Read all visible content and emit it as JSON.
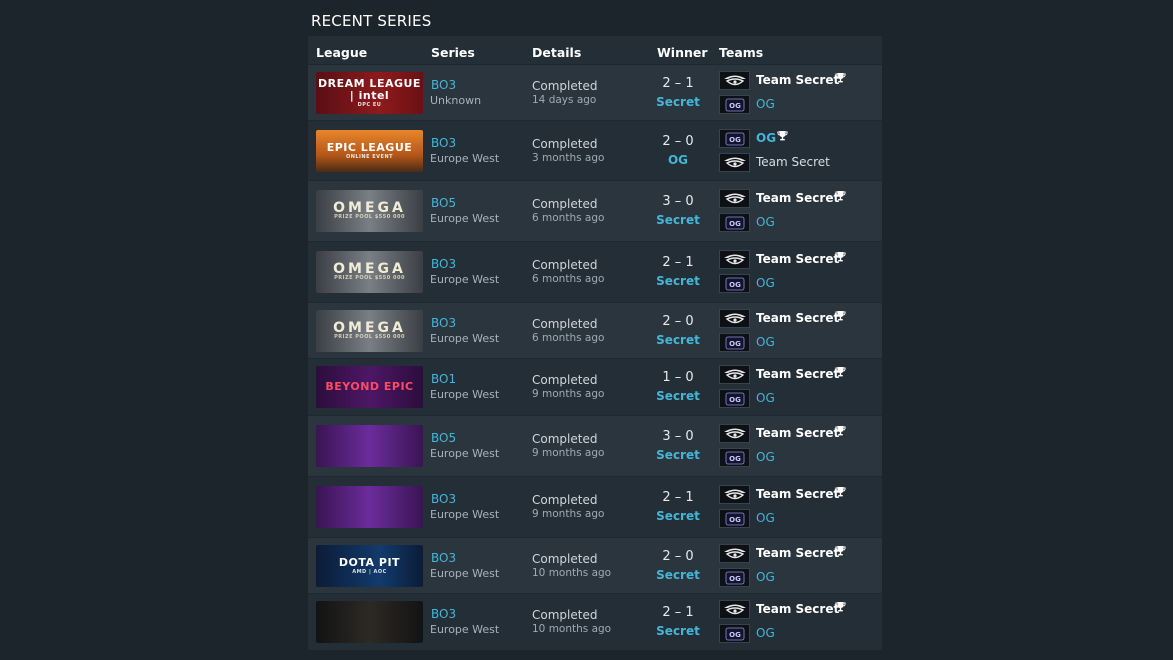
{
  "section_title": "RECENT SERIES",
  "columns": {
    "league": "League",
    "series": "Series",
    "details": "Details",
    "winner": "Winner",
    "teams": "Teams"
  },
  "colors": {
    "accent": "#44b6d8",
    "background": "#1c242c",
    "panel": "#242e36"
  },
  "icons": {
    "trophy": "trophy-icon",
    "secret": "team-secret-logo-icon",
    "og": "og-logo-icon"
  },
  "rows": [
    {
      "banner_title": "DREAM LEAGUE | intel",
      "banner_sub": "DPC EU",
      "banner_style": "dream",
      "series": "BO3",
      "region": "Unknown",
      "status": "Completed",
      "time": "14 days ago",
      "score": "2 – 1",
      "winner": "Secret",
      "team1": "Team Secret",
      "team2": "OG",
      "team1_logo": "secret",
      "team2_logo": "og",
      "team1_won": true
    },
    {
      "banner_title": "EPIC LEAGUE",
      "banner_sub": "ONLINE EVENT",
      "banner_style": "epic",
      "series": "BO3",
      "region": "Europe West",
      "status": "Completed",
      "time": "3 months ago",
      "score": "2 – 0",
      "winner": "OG",
      "team1": "OG",
      "team2": "Team Secret",
      "team1_logo": "og",
      "team2_logo": "secret",
      "team1_won": true
    },
    {
      "banner_title": "OMEGA",
      "banner_sub": "PRIZE POOL $550 000",
      "banner_style": "omega",
      "series": "BO5",
      "region": "Europe West",
      "status": "Completed",
      "time": "6 months ago",
      "score": "3 – 0",
      "winner": "Secret",
      "team1": "Team Secret",
      "team2": "OG",
      "team1_logo": "secret",
      "team2_logo": "og",
      "team1_won": true
    },
    {
      "banner_title": "OMEGA",
      "banner_sub": "PRIZE POOL $550 000",
      "banner_style": "omega",
      "series": "BO3",
      "region": "Europe West",
      "status": "Completed",
      "time": "6 months ago",
      "score": "2 – 1",
      "winner": "Secret",
      "team1": "Team Secret",
      "team2": "OG",
      "team1_logo": "secret",
      "team2_logo": "og",
      "team1_won": true
    },
    {
      "banner_title": "OMEGA",
      "banner_sub": "PRIZE POOL $550 000",
      "banner_style": "omega",
      "series": "BO3",
      "region": "Europe West",
      "status": "Completed",
      "time": "6 months ago",
      "score": "2 – 0",
      "winner": "Secret",
      "team1": "Team Secret",
      "team2": "OG",
      "team1_logo": "secret",
      "team2_logo": "og",
      "team1_won": true
    },
    {
      "banner_title": "BEYOND EPIC",
      "banner_sub": "",
      "banner_style": "beyond",
      "series": "BO1",
      "region": "Europe West",
      "status": "Completed",
      "time": "9 months ago",
      "score": "1 – 0",
      "winner": "Secret",
      "team1": "Team Secret",
      "team2": "OG",
      "team1_logo": "secret",
      "team2_logo": "og",
      "team1_won": true
    },
    {
      "banner_title": "",
      "banner_sub": "",
      "banner_style": "party",
      "series": "BO5",
      "region": "Europe West",
      "status": "Completed",
      "time": "9 months ago",
      "score": "3 – 0",
      "winner": "Secret",
      "team1": "Team Secret",
      "team2": "OG",
      "team1_logo": "secret",
      "team2_logo": "og",
      "team1_won": true
    },
    {
      "banner_title": "",
      "banner_sub": "",
      "banner_style": "party",
      "series": "BO3",
      "region": "Europe West",
      "status": "Completed",
      "time": "9 months ago",
      "score": "2 – 1",
      "winner": "Secret",
      "team1": "Team Secret",
      "team2": "OG",
      "team1_logo": "secret",
      "team2_logo": "og",
      "team1_won": true
    },
    {
      "banner_title": "DOTA PIT",
      "banner_sub": "AMD | AOC",
      "banner_style": "pit",
      "series": "BO3",
      "region": "Europe West",
      "status": "Completed",
      "time": "10 months ago",
      "score": "2 – 0",
      "winner": "Secret",
      "team1": "Team Secret",
      "team2": "OG",
      "team1_logo": "secret",
      "team2_logo": "og",
      "team1_won": true
    },
    {
      "banner_title": "",
      "banner_sub": "",
      "banner_style": "wk",
      "series": "BO3",
      "region": "Europe West",
      "status": "Completed",
      "time": "10 months ago",
      "score": "2 – 1",
      "winner": "Secret",
      "team1": "Team Secret",
      "team2": "OG",
      "team1_logo": "secret",
      "team2_logo": "og",
      "team1_won": true
    }
  ]
}
